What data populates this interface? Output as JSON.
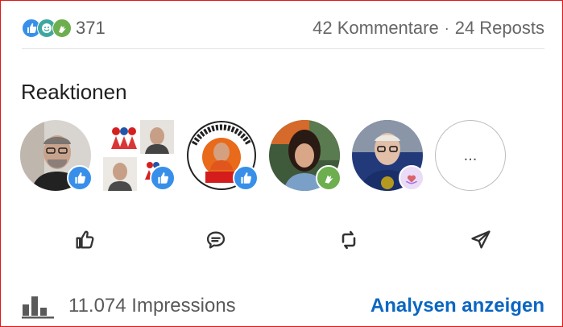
{
  "reactions_count": "371",
  "comments": "42 Kommentare",
  "separator": "·",
  "reposts": "24 Reposts",
  "section_title": "Reaktionen",
  "more_label": "...",
  "impressions": "11.074 Impressions",
  "analytics_link": "Analysen anzeigen",
  "colors": {
    "like": "#378fe9",
    "celebrate": "#6dae4f",
    "support": "#a872e8",
    "link": "#0a66c2"
  }
}
